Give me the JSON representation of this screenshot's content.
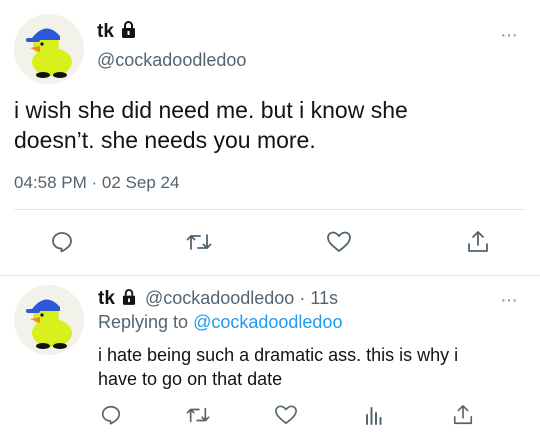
{
  "main_tweet": {
    "display_name": "tk",
    "handle": "@cockadoodledoo",
    "text_line1": "i wish she did need me. but i know she",
    "text_line2": "doesn’t. she needs you more.",
    "time": "04:58 PM",
    "separator": "·",
    "date": "02 Sep 24",
    "more_label": "···"
  },
  "reply_tweet": {
    "display_name": "tk",
    "handle": "@cockadoodledoo",
    "separator": "·",
    "age": "11s",
    "replying_prefix": "Replying to",
    "replying_handle": "@cockadoodledoo",
    "text_line1": "i hate being such a dramatic ass. this is why i",
    "text_line2": "have to go on that date",
    "more_label": "···"
  },
  "icons": {
    "lock": "lock-icon",
    "reply": "reply-icon",
    "retweet": "retweet-icon",
    "like": "heart-icon",
    "analytics": "analytics-icon",
    "share": "share-icon",
    "avatar": "duck-avatar"
  },
  "colors": {
    "text": "#0f1419",
    "secondary": "#536471",
    "link": "#1d9bf0",
    "icon": "#536471",
    "divider": "#e6e9ec",
    "duck_yellow": "#d8f01c",
    "cap_blue": "#2d58d6",
    "beak_orange": "#f08a1c"
  }
}
